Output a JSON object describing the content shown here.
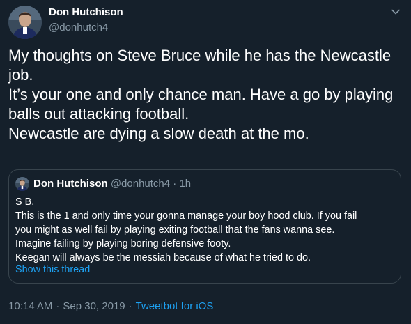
{
  "author": {
    "name": "Don Hutchison",
    "handle": "@donhutch4"
  },
  "tweet_lines": [
    "My thoughts on Steve Bruce while he has the Newcastle",
    "job.",
    "It’s your one and only chance man. Have a go by playing",
    "balls out attacking football.",
    "Newcastle are dying a slow death at the mo."
  ],
  "quoted": {
    "name": "Don Hutchison",
    "handle": "@donhutch4",
    "dot": "·",
    "time": "1h",
    "lines": [
      "S B.",
      "This is the 1 and only time your gonna manage your boy hood club. If you fail",
      "you might as well fail by playing exiting football that the fans wanna see.",
      "Imagine failing by playing boring defensive footy.",
      "Keegan will always be the messiah because of what he tried to do."
    ],
    "show_thread": "Show this thread"
  },
  "meta": {
    "time": "10:14 AM",
    "date": "Sep 30, 2019",
    "sep": "·",
    "source": "Tweetbot for iOS"
  },
  "colors": {
    "background": "#15202b",
    "secondary_text": "#8899a6",
    "link": "#1da1f2",
    "border": "#38444d"
  },
  "icons": {
    "caret": "chevron-down-icon"
  }
}
